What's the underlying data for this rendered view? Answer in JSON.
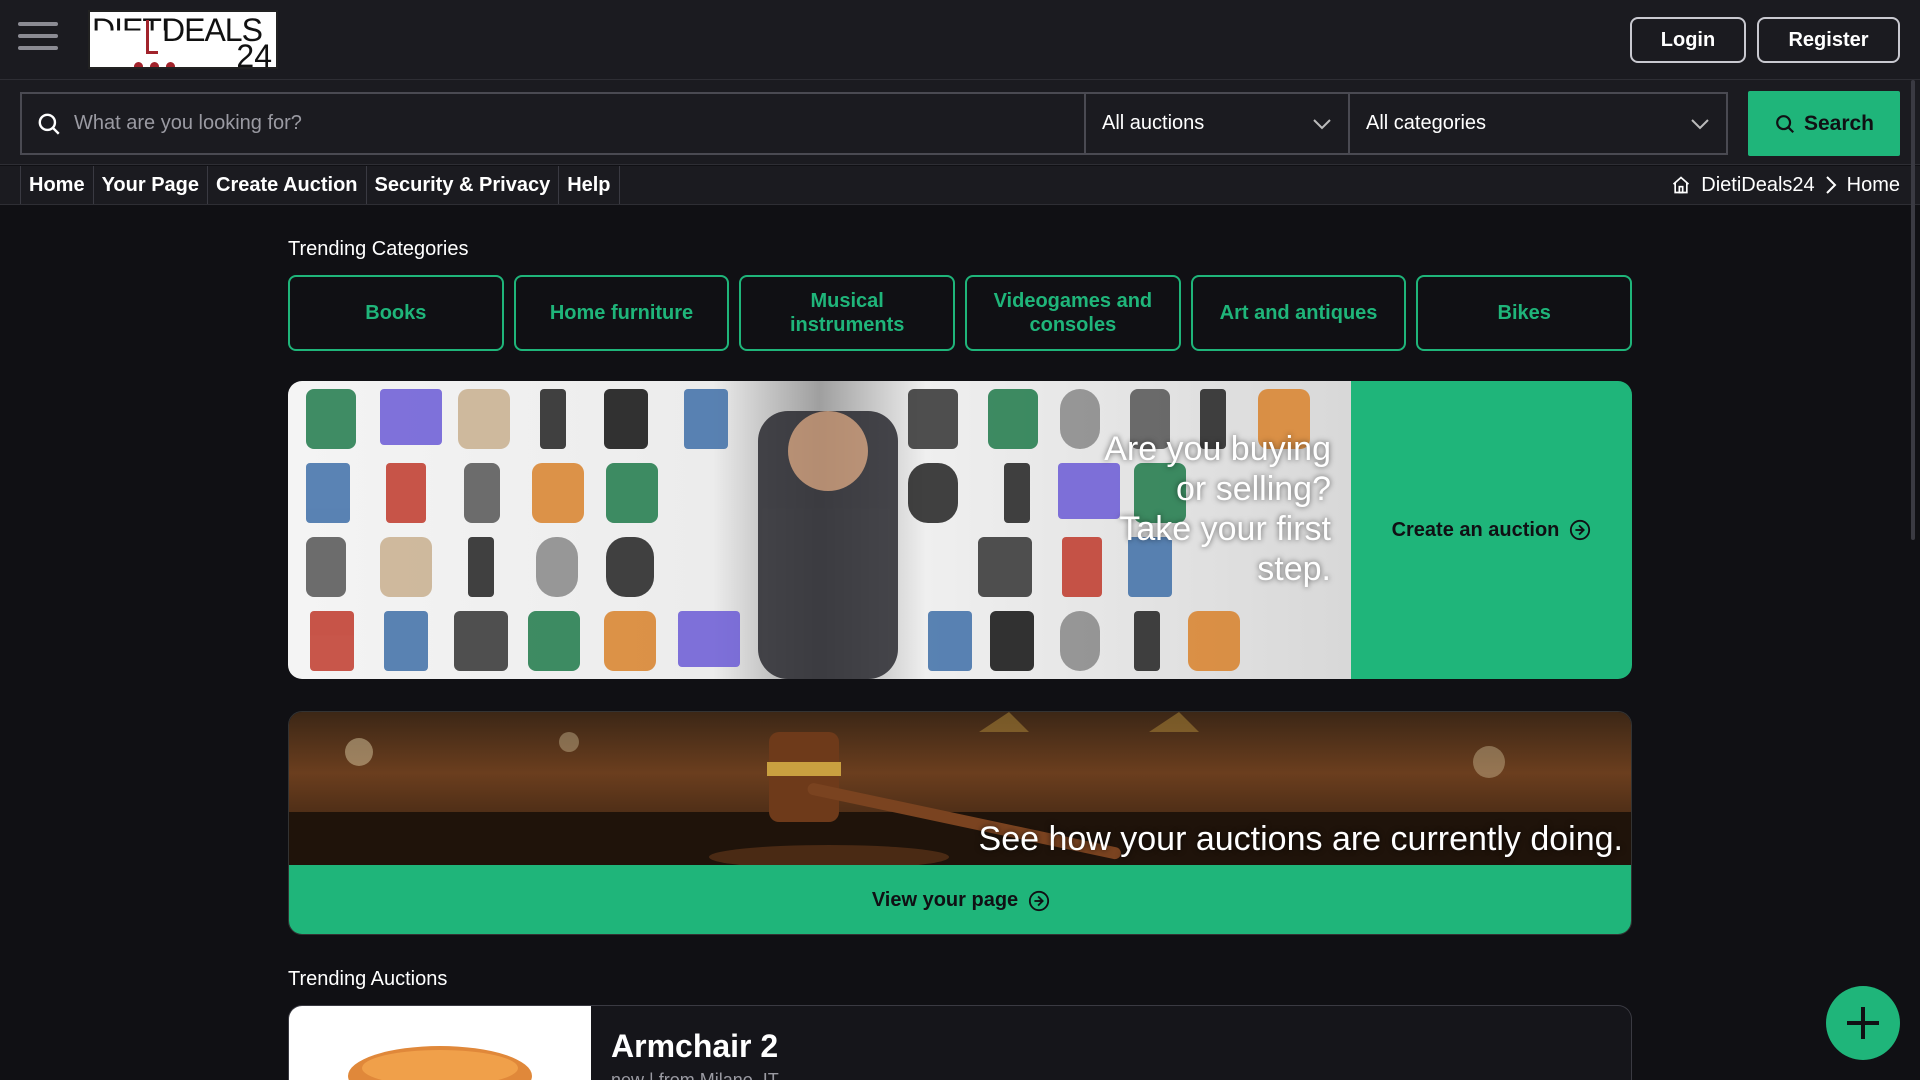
{
  "header": {
    "logo_text_1": "DIETI",
    "logo_text_2": "DEALS",
    "logo_text_3": "24",
    "login_label": "Login",
    "register_label": "Register"
  },
  "search": {
    "placeholder": "What are you looking for?",
    "auction_filter": "All auctions",
    "category_filter": "All categories",
    "button_label": "Search"
  },
  "nav": {
    "items": [
      "Home",
      "Your Page",
      "Create Auction",
      "Security & Privacy",
      "Help"
    ]
  },
  "breadcrumb": {
    "root": "DietiDeals24",
    "current": "Home"
  },
  "trending_categories": {
    "title": "Trending Categories",
    "items": [
      "Books",
      "Home furniture",
      "Musical instruments",
      "Videogames and consoles",
      "Art and antiques",
      "Bikes"
    ]
  },
  "hero": {
    "text": "Are you buying or selling? Take your first step.",
    "cta_label": "Create an auction"
  },
  "banner2": {
    "text": "See how your auctions are currently doing.",
    "cta_label": "View your page"
  },
  "trending_auctions": {
    "title": "Trending Auctions",
    "first_item_title": "Armchair 2",
    "first_item_meta": "new | from Milano, IT"
  },
  "colors": {
    "accent": "#1fb57a",
    "background": "#101014",
    "logo_red": "#a1232b"
  },
  "icons": [
    "menu-icon",
    "search-icon",
    "chevron-down-icon",
    "home-icon",
    "chevron-right-icon",
    "arrow-circle-right-icon",
    "plus-icon"
  ]
}
